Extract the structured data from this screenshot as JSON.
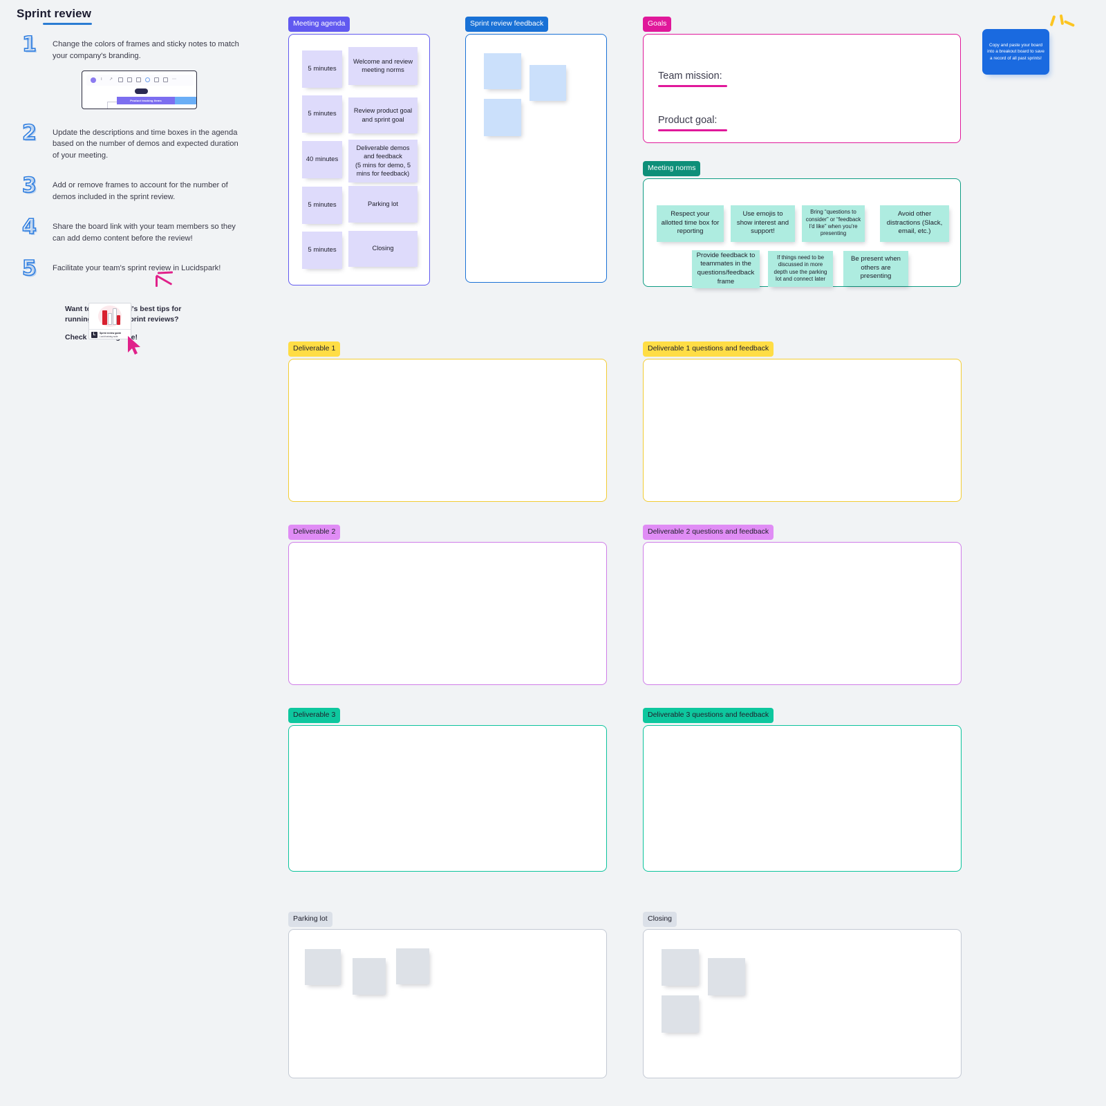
{
  "board": {
    "title": "Sprint review",
    "steps": [
      {
        "num": "1",
        "text": "Change the colors of frames and sticky notes to match your company's branding."
      },
      {
        "num": "2",
        "text": "Update the descriptions and time boxes in the agenda based on the number of demos and expected duration of your meeting."
      },
      {
        "num": "3",
        "text": "Add or remove frames to account for the number of demos included in the sprint review."
      },
      {
        "num": "4",
        "text": "Share the board link with your team members so they can add demo content before the review!"
      },
      {
        "num": "5",
        "text": "Facilitate your team's sprint review in Lucidspark!"
      }
    ],
    "toolbar_preview": {
      "bar_label": "Product tracking items"
    },
    "guide": {
      "lead": "Want to learn Lucid's best tips for running effective sprint reviews?",
      "cta": "Check out our guide!",
      "card_title": "Sprint review guide",
      "card_subtitle": "Lucid training suite",
      "card_logo": "L"
    }
  },
  "callout": {
    "text": "Copy and paste your board into a breakout board to save a record of all past sprints!",
    "color": "#1a6ae0"
  },
  "frames": {
    "meeting_agenda": {
      "label": "Meeting agenda",
      "label_bg": "#6159f0",
      "label_fg": "#ffffff",
      "border": "#6159f0",
      "rows": [
        {
          "time": "5 minutes",
          "desc": "Welcome and review meeting norms"
        },
        {
          "time": "5 minutes",
          "desc": "Review product goal and sprint goal"
        },
        {
          "time": "40 minutes",
          "desc": "Deliverable demos and feedback\n(5 mins for demo, 5 mins for feedback)"
        },
        {
          "time": "5 minutes",
          "desc": "Parking lot"
        },
        {
          "time": "5 minutes",
          "desc": "Closing"
        }
      ]
    },
    "sprint_review_feedback": {
      "label": "Sprint review feedback",
      "label_bg": "#1971d6",
      "label_fg": "#ffffff",
      "border": "#1971d6",
      "notes": [
        "",
        "",
        ""
      ],
      "note_color": "#cbe0fb"
    },
    "goals": {
      "label": "Goals",
      "label_bg": "#e0189a",
      "label_fg": "#ffffff",
      "border": "#e0189a",
      "lines": [
        "Team mission:",
        "Product goal:"
      ]
    },
    "meeting_norms": {
      "label": "Meeting norms",
      "label_bg": "#0e8f79",
      "label_fg": "#ffffff",
      "border": "#0e9c83",
      "note_color": "#aeece0",
      "notes": [
        "Respect your allotted time box for reporting",
        "Use emojis to show interest and support!",
        "Bring “questions to consider” or “feedback I'd like” when you're presenting",
        "Avoid other distractions (Slack, email, etc.)",
        "Provide feedback to teammates in the questions/feedback frame",
        "If things need to be discussed in more depth use the parking lot and connect later",
        "Be present when others are presenting"
      ]
    },
    "deliverable_1": {
      "label": "Deliverable 1",
      "label_bg": "#ffdd45",
      "label_fg": "#20202c",
      "border": "#f2cc33"
    },
    "deliverable_1_feedback": {
      "label": "Deliverable 1 questions and feedback",
      "label_bg": "#ffdd45",
      "label_fg": "#20202c",
      "border": "#f2cc33"
    },
    "deliverable_2": {
      "label": "Deliverable 2",
      "label_bg": "#e08cf5",
      "label_fg": "#20202c",
      "border": "#cf7ce8"
    },
    "deliverable_2_feedback": {
      "label": "Deliverable 2 questions and feedback",
      "label_bg": "#e08cf5",
      "label_fg": "#20202c",
      "border": "#cf7ce8"
    },
    "deliverable_3": {
      "label": "Deliverable 3",
      "label_bg": "#0ec79e",
      "label_fg": "#20202c",
      "border": "#0bc39c"
    },
    "deliverable_3_feedback": {
      "label": "Deliverable 3 questions and feedback",
      "label_bg": "#0ec79e",
      "label_fg": "#20202c",
      "border": "#0bc39c"
    },
    "parking_lot": {
      "label": "Parking lot",
      "label_bg": "#dbe0e8",
      "label_fg": "#20202c",
      "border": "#c3c9d3",
      "notes": [
        "",
        "",
        ""
      ],
      "note_color": "#dde1e7"
    },
    "closing": {
      "label": "Closing",
      "label_bg": "#dbe0e8",
      "label_fg": "#20202c",
      "border": "#c3c9d3",
      "notes": [
        "",
        "",
        ""
      ],
      "note_color": "#dde1e7"
    }
  }
}
